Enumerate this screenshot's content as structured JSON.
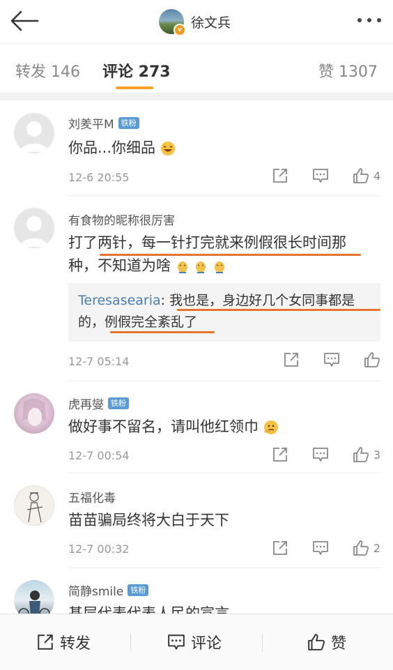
{
  "header": {
    "title": "徐文兵",
    "avatar_badge": "v"
  },
  "tabs": [
    {
      "label": "转发 146"
    },
    {
      "label": "评论 273"
    },
    {
      "label": "赞 1307"
    }
  ],
  "comments": [
    {
      "name": "刘羑平M",
      "badge": "铁粉",
      "text": "你品...你细品",
      "time": "12-6 20:55",
      "likes": "4"
    },
    {
      "name": "有食物的昵称很厉害",
      "badge": "",
      "text_line1": "打了两针，每一针打完就来例假很长时间那",
      "text_line2": "种，不知道为啥",
      "reply_name": "Teresasearia",
      "reply_line1": ": 我也是，身边好几个女同事都是",
      "reply_line2": "的，例假完全紊乱了",
      "time": "12-7 05:14",
      "likes": ""
    },
    {
      "name": "虎再燮",
      "badge": "铁粉",
      "text": "做好事不留名，请叫他红领巾",
      "time": "12-7 00:54",
      "likes": "3"
    },
    {
      "name": "五福化毒",
      "badge": "",
      "text": "苗苗骗局终将大白于天下",
      "time": "12-7 00:32",
      "likes": "2"
    },
    {
      "name": "简静smile",
      "badge": "铁粉",
      "text": "基层代表代表人民的宣言"
    }
  ],
  "bottom_bar": {
    "repost": "转发",
    "comment": "评论",
    "like": "赞"
  },
  "colors": {
    "accent": "#f7a429",
    "highlight": "#e8732c",
    "link": "#4a7db0",
    "fan_badge": "#5b9bd5"
  }
}
